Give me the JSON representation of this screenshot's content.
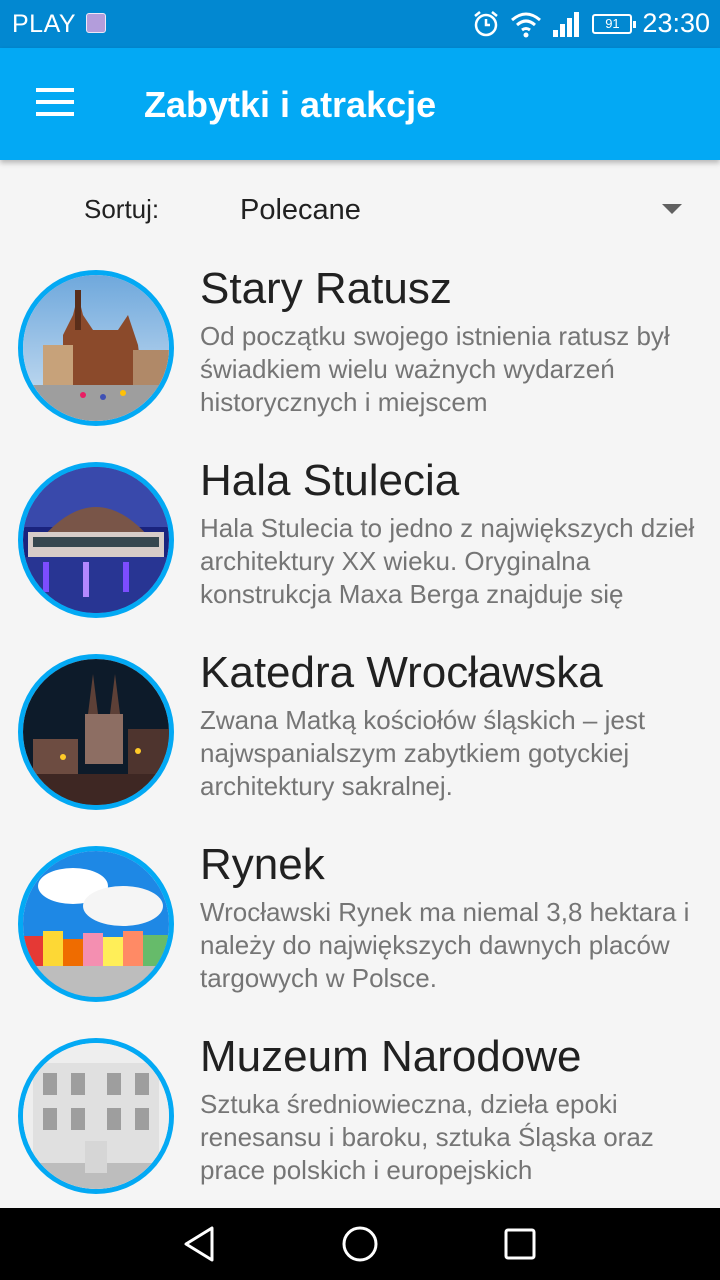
{
  "status_bar": {
    "carrier": "PLAY",
    "battery": "91",
    "time": "23:30",
    "icons": [
      "gallery-notification-icon",
      "alarm-icon",
      "wifi-icon",
      "signal-icon",
      "battery-icon"
    ]
  },
  "app_bar": {
    "title": "Zabytki i atrakcje",
    "menu_icon": "hamburger-menu-icon",
    "color": "#03a9f4"
  },
  "sort": {
    "label": "Sortuj:",
    "selected": "Polecane"
  },
  "attractions": [
    {
      "title": "Stary Ratusz",
      "description": "Od początku swojego istnienia ratusz był świadkiem wielu ważnych wydarzeń historycznych i miejscem"
    },
    {
      "title": "Hala Stulecia",
      "description": "Hala Stulecia to jedno z największych dzieł architektury XX wieku. Oryginalna konstrukcja Maxa Berga znajduje się"
    },
    {
      "title": "Katedra Wrocławska",
      "description": "Zwana Matką kościołów śląskich – jest najwspanialszym zabytkiem gotyckiej architektury sakralnej."
    },
    {
      "title": "Rynek",
      "description": "Wrocławski Rynek ma niemal 3,8 hektara i należy do największych dawnych placów targowych w Polsce."
    },
    {
      "title": "Muzeum Narodowe",
      "description": "Sztuka średniowieczna, dzieła epoki renesansu i baroku, sztuka Śląska oraz prace polskich i europejskich"
    }
  ],
  "nav_bar": {
    "icons": [
      "back-icon",
      "home-icon",
      "recents-icon"
    ]
  }
}
